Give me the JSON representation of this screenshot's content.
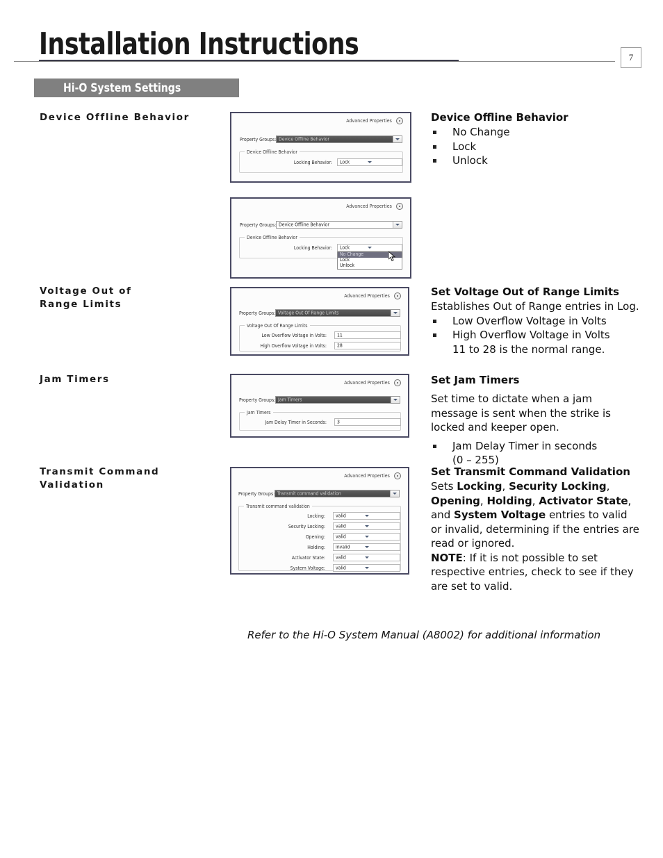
{
  "header": {
    "title": "Installation Instructions",
    "page_number": "7",
    "section_banner": "Hi-O System Settings"
  },
  "left_labels": [
    {
      "text": "Device Offline Behavior"
    },
    {
      "text": "Voltage Out of\nRange Limits"
    },
    {
      "text": "Jam Timers"
    },
    {
      "text": "Transmit Command\nValidation"
    }
  ],
  "screenshots": {
    "common": {
      "advanced_properties": "Advanced Properties",
      "property_groups_label": "Property Groups:"
    },
    "offline_closed": {
      "property_group_value": "Device Offline Behavior",
      "groupbox_title": "Device Offline Behavior",
      "field_label": "Locking Behavior:",
      "field_value": "Lock"
    },
    "offline_open": {
      "property_group_value": "Device Offline Behavior",
      "groupbox_title": "Device Offline Behavior",
      "field_label": "Locking Behavior:",
      "field_value": "Lock",
      "options": [
        "No Change",
        "Lock",
        "Unlock"
      ],
      "selected_option": "No Change"
    },
    "voltage": {
      "property_group_value": "Voltage Out Of Range Limits",
      "groupbox_title": "Voltage Out Of Range Limits",
      "rows": [
        {
          "label": "Low Overflow Voltage in Volts:",
          "value": "11"
        },
        {
          "label": "High Overflow Voltage in Volts:",
          "value": "28"
        }
      ]
    },
    "jam": {
      "property_group_value": "Jam Timers",
      "groupbox_title": "Jam Timers",
      "rows": [
        {
          "label": "Jam Delay Timer in Seconds:",
          "value": "3"
        }
      ]
    },
    "transmit": {
      "property_group_value": "Transmit command validation",
      "groupbox_title": "Transmit command validation",
      "rows": [
        {
          "label": "Locking:",
          "value": "valid"
        },
        {
          "label": "Security Locking:",
          "value": "valid"
        },
        {
          "label": "Opening:",
          "value": "valid"
        },
        {
          "label": "Holding:",
          "value": "invalid"
        },
        {
          "label": "Activator State:",
          "value": "valid"
        },
        {
          "label": "System Voltage:",
          "value": "valid"
        }
      ]
    }
  },
  "right_column": {
    "offline": {
      "heading": "Device Offline Behavior",
      "items": [
        "No Change",
        "Lock",
        "Unlock"
      ]
    },
    "voltage": {
      "heading": "Set Voltage Out of Range Limits",
      "paragraph": "Establishes Out of Range entries in Log.",
      "items": [
        "Low Overflow Voltage in Volts",
        "High Overflow Voltage in Volts"
      ],
      "subnote": "11 to 28 is the normal range."
    },
    "jam": {
      "heading": "Set Jam Timers",
      "paragraph": "Set time to dictate when a jam message is sent when the strike is locked and keeper open.",
      "items": [
        "Jam Delay Timer in seconds"
      ],
      "subnote": "(0 – 255)"
    },
    "transmit": {
      "heading": "Set Transmit Command Validation",
      "sets_prefix": "Sets ",
      "bold_terms": [
        "Locking",
        "Security Locking",
        "Opening",
        "Holding",
        "Activator State",
        "System Voltage"
      ],
      "and_word": "and",
      "tail": "entries to valid or invalid, determining if the entries are read or ignored.",
      "note_label": "NOTE",
      "note_text": ": If it is not possible to set respective entries, check to see if they are set to valid."
    }
  },
  "footer": {
    "note": "Refer to the Hi-O System Manual (A8002) for additional information"
  },
  "colors": {
    "banner": "#808080",
    "panel_border": "#4a4a63",
    "title_rule": "#3b3b4a"
  }
}
